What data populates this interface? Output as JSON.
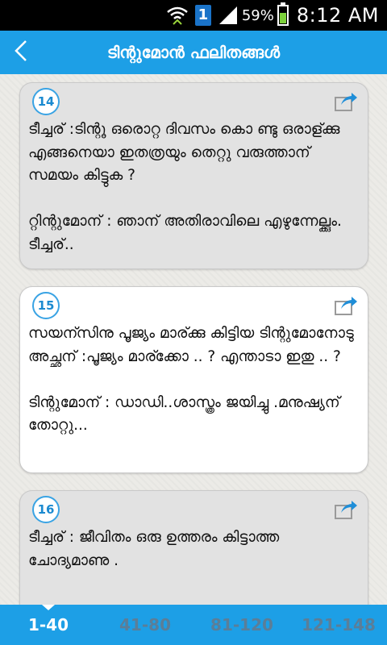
{
  "status_bar": {
    "battery_percent": "59%",
    "clock": "8:12 AM",
    "sim_label": "1",
    "icons": [
      "wifi-icon",
      "sim-icon",
      "signal-icon",
      "battery-icon"
    ]
  },
  "header": {
    "title": "ടിന്റുമോൻ ഫലിതങ്ങൾ",
    "back_icon": "chevron-left-icon"
  },
  "cards": [
    {
      "number": "14",
      "text": "ടീച്ചര് :ടിന്റൂ ഒരൊറ്റ ദിവസം കൊ ണ്ടു ഒരാള്ക്കു എങ്ങനെയാ ഇതത്രയും തെറ്റു വരുത്താന് സമയം കിട്ടുക ?\n\nറ്റിന്റുമോന് : ഞാന് അതിരാവിലെ എഴുന്നേല്ക്കും. ടീച്ചര്..",
      "share_icon": "share-icon"
    },
    {
      "number": "15",
      "text": "സയന്സിനു പൂജ്യം മാര്ക്കു കിട്ടിയ ടിന്റുമോനോടു അച്ഛന് :പൂജ്യം മാര്ക്കോ .. ? എന്താടാ ഇതു .. ?\n\nടിന്റുമോന് : ഡാഡി..ശാസ്ത്രം ജയിച്ചു .മനുഷ്യന് തോറ്റു...",
      "share_icon": "share-icon"
    },
    {
      "number": "16",
      "text": "ടീച്ചര് : ജീവിതം ഒരു ഉത്തരം കിട്ടാത്ത ചോദ്യമാണു .",
      "share_icon": "share-icon"
    }
  ],
  "tabs": [
    {
      "label": "1-40",
      "active": true
    },
    {
      "label": "41-80",
      "active": false
    },
    {
      "label": "81-120",
      "active": false
    },
    {
      "label": "121-148",
      "active": false
    }
  ],
  "colors": {
    "accent": "#1d9fe6",
    "badge_border": "#39a3e4",
    "inactive_tab": "#5b7e98"
  }
}
